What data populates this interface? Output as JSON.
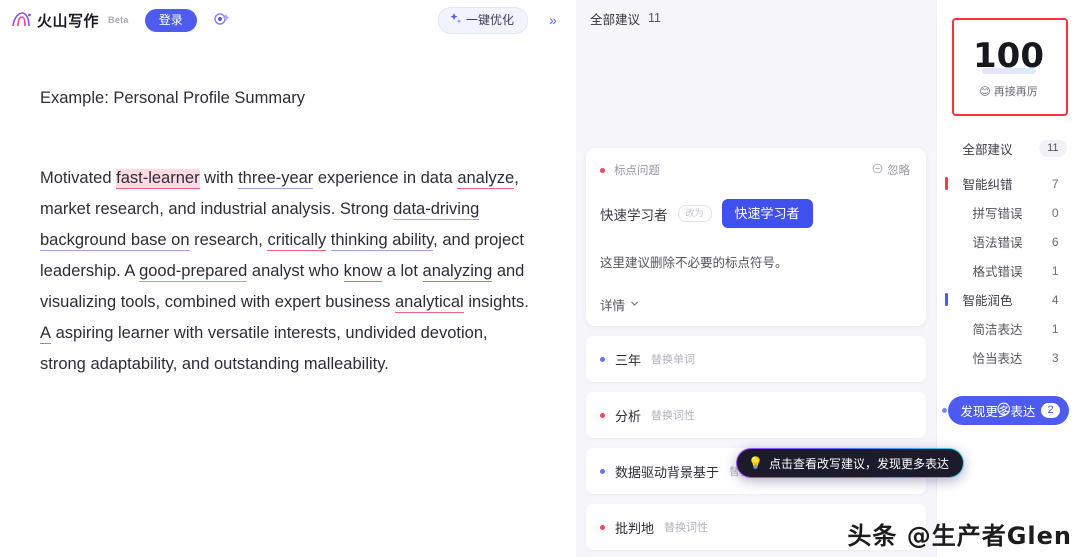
{
  "header": {
    "logo_text": "火山写作",
    "beta_tag": "Beta",
    "login_label": "登录",
    "ai_icon": "ai-sparkle-icon",
    "optimize_label": "一键优化",
    "optimize_icon": "sparkle-icon",
    "expand_label": "»"
  },
  "document": {
    "title": "Example: Personal Profile Summary",
    "paragraph_segments": [
      {
        "text": "Motivated ",
        "mark": "none"
      },
      {
        "text": "fast-learner",
        "mark": "error-highlight"
      },
      {
        "text": " with ",
        "mark": "none"
      },
      {
        "text": "three-year",
        "mark": "polish"
      },
      {
        "text": " experience in data ",
        "mark": "none"
      },
      {
        "text": "analyze",
        "mark": "error"
      },
      {
        "text": ", market research, and industrial analysis. Strong ",
        "mark": "none"
      },
      {
        "text": "data-driving background base on",
        "mark": "polish"
      },
      {
        "text": " research, ",
        "mark": "none"
      },
      {
        "text": "critically",
        "mark": "error"
      },
      {
        "text": " ",
        "mark": "none"
      },
      {
        "text": "thinking ability",
        "mark": "polish"
      },
      {
        "text": ", and project leadership. A ",
        "mark": "none"
      },
      {
        "text": "good-prepared",
        "mark": "polish"
      },
      {
        "text": " analyst who ",
        "mark": "none"
      },
      {
        "text": "know",
        "mark": "error"
      },
      {
        "text": " a lot ",
        "mark": "none"
      },
      {
        "text": "analyzing",
        "mark": "error"
      },
      {
        "text": " and visualizing tools, combined with expert business ",
        "mark": "none"
      },
      {
        "text": "analytical",
        "mark": "error"
      },
      {
        "text": " insights. ",
        "mark": "none"
      },
      {
        "text": "A",
        "mark": "error"
      },
      {
        "text": " aspiring learner with versatile interests, undivided devotion, strong adaptability, and outstanding malleability.",
        "mark": "none"
      }
    ]
  },
  "suggestions_panel": {
    "header_label": "全部建议",
    "header_count": "11",
    "active_card": {
      "kind": "标点问题",
      "kind_dot": "error",
      "ignore_label": "忽略",
      "ignore_icon": "circle-minus-icon",
      "original_text": "快速学习者",
      "arrow_label": "改为",
      "replacement_text": "快速学习者",
      "description": "这里建议删除不必要的标点符号。",
      "more_label": "详情",
      "more_icon": "chevron-down-icon"
    },
    "items": [
      {
        "word": "三年",
        "kind": "替换单词",
        "dot": "polish"
      },
      {
        "word": "分析",
        "kind": "替换词性",
        "dot": "error"
      },
      {
        "word": "数据驱动背景基于",
        "kind": "替换句式",
        "dot": "polish"
      },
      {
        "word": "批判地",
        "kind": "替换词性",
        "dot": "error"
      }
    ],
    "tooltip": {
      "icon": "lightbulb-icon",
      "text": "点击查看改写建议，发现更多表达"
    }
  },
  "sidebar": {
    "score_value": "100",
    "score_label": "再接再厉",
    "score_emoji": "😊",
    "categories": [
      {
        "name": "全部建议",
        "count": "11",
        "level": "all",
        "bar": "none"
      },
      {
        "name": "智能纠错",
        "count": "7",
        "level": "top",
        "bar": "error"
      },
      {
        "name": "拼写错误",
        "count": "0",
        "level": "sub",
        "bar": "none"
      },
      {
        "name": "语法错误",
        "count": "6",
        "level": "sub",
        "bar": "none"
      },
      {
        "name": "格式错误",
        "count": "1",
        "level": "sub",
        "bar": "none"
      },
      {
        "name": "智能润色",
        "count": "4",
        "level": "top",
        "bar": "polish"
      },
      {
        "name": "简洁表达",
        "count": "1",
        "level": "sub",
        "bar": "none"
      },
      {
        "name": "恰当表达",
        "count": "3",
        "level": "sub",
        "bar": "none"
      }
    ],
    "discover_label": "发现更多表达",
    "discover_badge": "2",
    "discover_emoji": "🌕"
  },
  "watermark": "头条 @生产者Glen",
  "colors": {
    "accent": "#4d5bf0",
    "error": "#ee3b53",
    "polish": "#4a5bef",
    "highlight_box": "#f5333f",
    "panel_bg": "#f6f6fb"
  }
}
